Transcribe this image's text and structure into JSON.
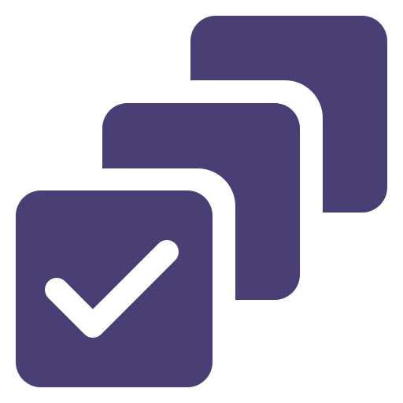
{
  "icon": {
    "name": "stacked-checkbox-icon",
    "fill_color": "#4a3f74",
    "check_color": "#ffffff",
    "background": "#ffffff"
  }
}
